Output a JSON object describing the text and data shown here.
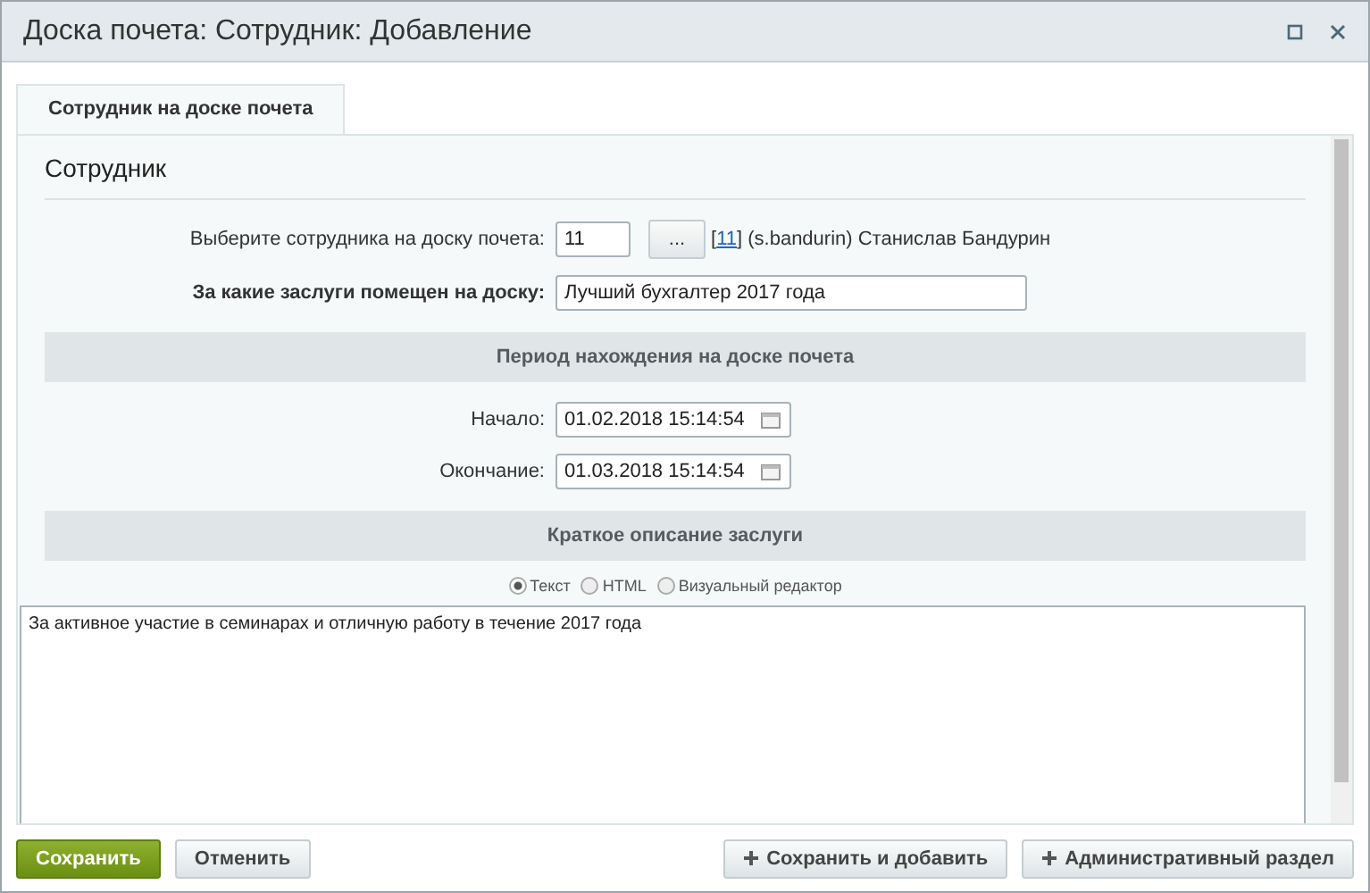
{
  "window": {
    "title": "Доска почета: Сотрудник: Добавление"
  },
  "tabs": [
    {
      "label": "Сотрудник на доске почета",
      "selected": true
    }
  ],
  "section_title": "Сотрудник",
  "employee": {
    "label": "Выберите сотрудника на доску почета:",
    "value": "11",
    "picker": "...",
    "link": "11",
    "bracket_open": "[",
    "bracket_close": "]",
    "info": "(s.bandurin) Станислав Бандурин"
  },
  "merit": {
    "label": "За какие заслуги помещен на доску:",
    "value": "Лучший бухгалтер 2017 года"
  },
  "period_header": "Период нахождения на доске почета",
  "dates": [
    {
      "label": "Начало:",
      "value": "01.02.2018 15:14:54"
    },
    {
      "label": "Окончание:",
      "value": "01.03.2018 15:14:54"
    }
  ],
  "description_header": "Краткое описание заслуги",
  "modes": [
    {
      "label": "Текст",
      "selected": true
    },
    {
      "label": "HTML",
      "selected": false
    },
    {
      "label": "Визуальный редактор",
      "selected": false
    }
  ],
  "description": "За активное участие в семинарах и отличную работу в течение 2017 года",
  "buttons": [
    {
      "label": "Сохранить",
      "kind": "primary"
    },
    {
      "label": "Отменить",
      "kind": "plain"
    },
    {
      "label": "Сохранить и добавить",
      "kind": "add"
    },
    {
      "label": "Административный раздел",
      "kind": "add"
    }
  ]
}
